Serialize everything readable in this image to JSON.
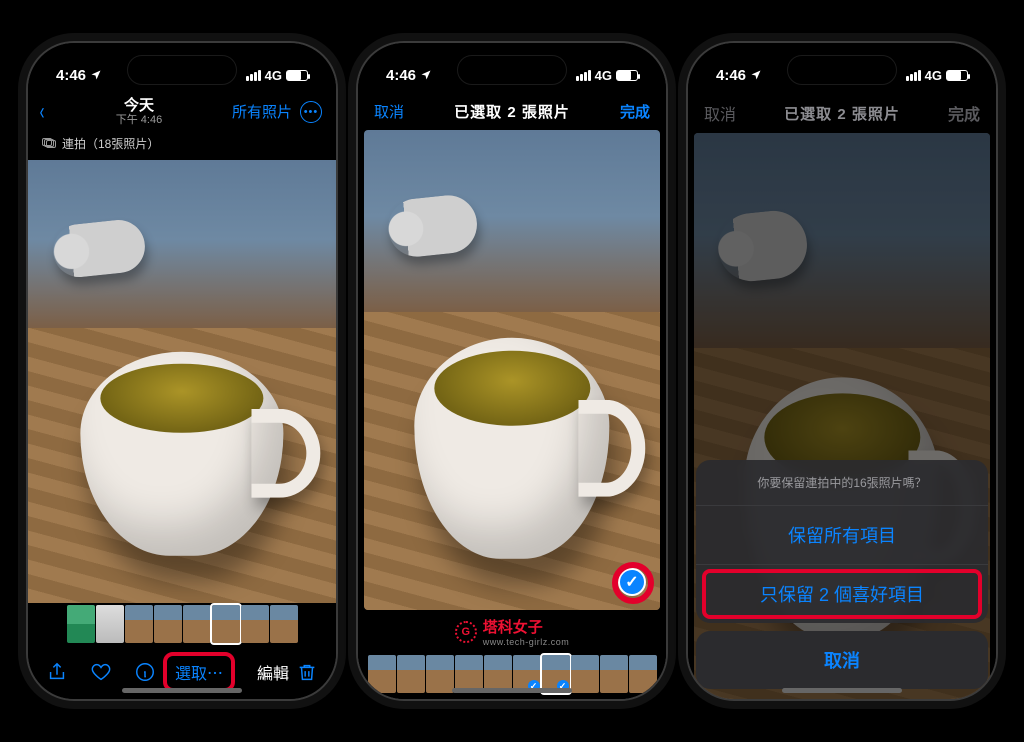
{
  "status": {
    "time": "4:46",
    "network": "4G"
  },
  "phone1": {
    "nav": {
      "title": "今天",
      "subtitle": "下午 4:46",
      "all_photos": "所有照片"
    },
    "burst_label": "連拍（18張照片）",
    "toolbar": {
      "select": "選取⋯",
      "edit": "編輯"
    }
  },
  "phone2": {
    "nav": {
      "cancel": "取消",
      "title": "已選取 2 張照片",
      "done": "完成"
    },
    "watermark": {
      "name": "塔科女子",
      "sub": "www.tech-girlz.com"
    }
  },
  "phone3": {
    "nav": {
      "cancel": "取消",
      "title": "已選取 2 張照片",
      "done": "完成"
    },
    "sheet": {
      "message": "你要保留連拍中的16張照片嗎？",
      "keep_all": "保留所有項目",
      "keep_fav": "只保留 2 個喜好項目",
      "cancel": "取消"
    }
  }
}
